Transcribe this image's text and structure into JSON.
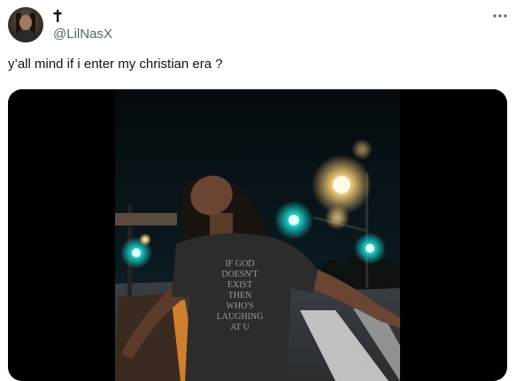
{
  "tweet": {
    "display_name_icon": "cross-icon",
    "handle": "@LilNasX",
    "text": "y’all mind if i enter my christian era ?",
    "more_icon": "more-icon",
    "shirt_text": "IF GOD DOESN'T EXIST THEN WHO'S LAUGHING AT U"
  },
  "colors": {
    "text_primary": "#0f1419",
    "text_secondary": "#536471",
    "traffic_light": "#18d8d0",
    "street_light": "#ffd27a"
  }
}
